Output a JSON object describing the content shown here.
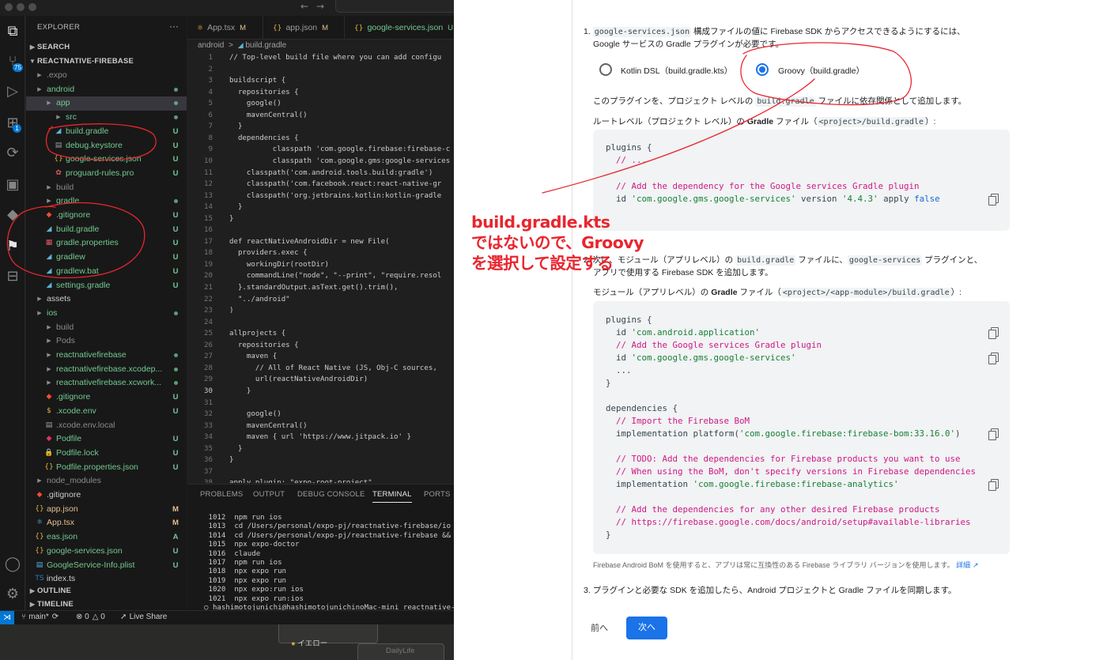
{
  "vscode": {
    "explorer_title": "EXPLORER",
    "search_section": "SEARCH",
    "project_section": "REACTNATIVE-FIREBASE",
    "outline_section": "OUTLINE",
    "timeline_section": "TIMELINE",
    "scm_badge": "75",
    "ext_badge": "1",
    "tree": [
      {
        "label": ".expo",
        "kind": "folder",
        "depth": 1,
        "color": "gray",
        "status": ""
      },
      {
        "label": "android",
        "kind": "folder",
        "depth": 1,
        "color": "green",
        "status": "dot"
      },
      {
        "label": "app",
        "kind": "folder",
        "depth": 2,
        "color": "green",
        "status": "dot",
        "selected": true
      },
      {
        "label": "src",
        "kind": "folder",
        "depth": 3,
        "color": "green",
        "status": "dot"
      },
      {
        "label": "build.gradle",
        "kind": "gradle",
        "depth": 3,
        "color": "green",
        "status": "U"
      },
      {
        "label": "debug.keystore",
        "kind": "file",
        "depth": 3,
        "color": "green",
        "status": "U"
      },
      {
        "label": "google-services.json",
        "kind": "json",
        "depth": 3,
        "color": "green",
        "status": "U"
      },
      {
        "label": "proguard-rules.pro",
        "kind": "pro",
        "depth": 3,
        "color": "green",
        "status": "U"
      },
      {
        "label": "build",
        "kind": "folder",
        "depth": 2,
        "color": "gray",
        "status": ""
      },
      {
        "label": "gradle",
        "kind": "folder",
        "depth": 2,
        "color": "green",
        "status": "dot"
      },
      {
        "label": ".gitignore",
        "kind": "git",
        "depth": 2,
        "color": "green",
        "status": "U"
      },
      {
        "label": "build.gradle",
        "kind": "gradle",
        "depth": 2,
        "color": "green",
        "status": "U"
      },
      {
        "label": "gradle.properties",
        "kind": "props",
        "depth": 2,
        "color": "green",
        "status": "U"
      },
      {
        "label": "gradlew",
        "kind": "gradle",
        "depth": 2,
        "color": "green",
        "status": "U"
      },
      {
        "label": "gradlew.bat",
        "kind": "gradle",
        "depth": 2,
        "color": "green",
        "status": "U"
      },
      {
        "label": "settings.gradle",
        "kind": "gradle",
        "depth": 2,
        "color": "green",
        "status": "U"
      },
      {
        "label": "assets",
        "kind": "folder",
        "depth": 1,
        "color": "white",
        "status": ""
      },
      {
        "label": "ios",
        "kind": "folder",
        "depth": 1,
        "color": "green",
        "status": "dot"
      },
      {
        "label": "build",
        "kind": "folder",
        "depth": 2,
        "color": "gray",
        "status": ""
      },
      {
        "label": "Pods",
        "kind": "folder",
        "depth": 2,
        "color": "gray",
        "status": ""
      },
      {
        "label": "reactnativefirebase",
        "kind": "folder",
        "depth": 2,
        "color": "green",
        "status": "dot"
      },
      {
        "label": "reactnativefirebase.xcodep...",
        "kind": "folder",
        "depth": 2,
        "color": "green",
        "status": "dot"
      },
      {
        "label": "reactnativefirebase.xcwork...",
        "kind": "folder",
        "depth": 2,
        "color": "green",
        "status": "dot"
      },
      {
        "label": ".gitignore",
        "kind": "git",
        "depth": 2,
        "color": "green",
        "status": "U"
      },
      {
        "label": ".xcode.env",
        "kind": "env",
        "depth": 2,
        "color": "green",
        "status": "U"
      },
      {
        "label": ".xcode.env.local",
        "kind": "file",
        "depth": 2,
        "color": "gray",
        "status": ""
      },
      {
        "label": "Podfile",
        "kind": "ruby",
        "depth": 2,
        "color": "green",
        "status": "U"
      },
      {
        "label": "Podfile.lock",
        "kind": "lock",
        "depth": 2,
        "color": "green",
        "status": "U"
      },
      {
        "label": "Podfile.properties.json",
        "kind": "json",
        "depth": 2,
        "color": "green",
        "status": "U"
      },
      {
        "label": "node_modules",
        "kind": "folder",
        "depth": 1,
        "color": "gray",
        "status": ""
      },
      {
        "label": ".gitignore",
        "kind": "git",
        "depth": 1,
        "color": "white",
        "status": ""
      },
      {
        "label": "app.json",
        "kind": "json",
        "depth": 1,
        "color": "orange",
        "status": "M"
      },
      {
        "label": "App.tsx",
        "kind": "tsx",
        "depth": 1,
        "color": "orange",
        "status": "M"
      },
      {
        "label": "eas.json",
        "kind": "json",
        "depth": 1,
        "color": "green",
        "status": "A"
      },
      {
        "label": "google-services.json",
        "kind": "json",
        "depth": 1,
        "color": "green",
        "status": "U"
      },
      {
        "label": "GoogleService-Info.plist",
        "kind": "plist",
        "depth": 1,
        "color": "green",
        "status": "U"
      },
      {
        "label": "index.ts",
        "kind": "ts",
        "depth": 1,
        "color": "white",
        "status": ""
      }
    ],
    "tabs": [
      {
        "label": "App.tsx",
        "mod": "M"
      },
      {
        "label": "app.json",
        "mod": "M"
      },
      {
        "label": "google-services.json",
        "mod": "U"
      }
    ],
    "breadcrumb": {
      "folder": "android",
      "sep": ">",
      "file": "build.gradle"
    },
    "code_lines": [
      {
        "n": "1",
        "t": "// Top-level build file where you can add configu"
      },
      {
        "n": "2",
        "t": ""
      },
      {
        "n": "3",
        "t": "buildscript {"
      },
      {
        "n": "4",
        "t": "  repositories {"
      },
      {
        "n": "5",
        "t": "    google()"
      },
      {
        "n": "6",
        "t": "    mavenCentral()"
      },
      {
        "n": "7",
        "t": "  }"
      },
      {
        "n": "8",
        "t": "  dependencies {"
      },
      {
        "n": "9",
        "t": "          classpath 'com.google.firebase:firebase-c"
      },
      {
        "n": "10",
        "t": "          classpath 'com.google.gms:google-services"
      },
      {
        "n": "11",
        "t": "    classpath('com.android.tools.build:gradle')"
      },
      {
        "n": "12",
        "t": "    classpath('com.facebook.react:react-native-gr"
      },
      {
        "n": "13",
        "t": "    classpath('org.jetbrains.kotlin:kotlin-gradle"
      },
      {
        "n": "14",
        "t": "  }"
      },
      {
        "n": "15",
        "t": "}"
      },
      {
        "n": "16",
        "t": ""
      },
      {
        "n": "17",
        "t": "def reactNativeAndroidDir = new File("
      },
      {
        "n": "18",
        "t": "  providers.exec {"
      },
      {
        "n": "19",
        "t": "    workingDir(rootDir)"
      },
      {
        "n": "20",
        "t": "    commandLine(\"node\", \"--print\", \"require.resol"
      },
      {
        "n": "21",
        "t": "  }.standardOutput.asText.get().trim(),"
      },
      {
        "n": "22",
        "t": "  \"../android\""
      },
      {
        "n": "23",
        "t": ")"
      },
      {
        "n": "24",
        "t": ""
      },
      {
        "n": "25",
        "t": "allprojects {"
      },
      {
        "n": "26",
        "t": "  repositories {"
      },
      {
        "n": "27",
        "t": "    maven {"
      },
      {
        "n": "28",
        "t": "      // All of React Native (JS, Obj-C sources,"
      },
      {
        "n": "29",
        "t": "      url(reactNativeAndroidDir)"
      },
      {
        "n": "30",
        "t": "    }"
      },
      {
        "n": "31",
        "t": ""
      },
      {
        "n": "32",
        "t": "    google()"
      },
      {
        "n": "33",
        "t": "    mavenCentral()"
      },
      {
        "n": "34",
        "t": "    maven { url 'https://www.jitpack.io' }"
      },
      {
        "n": "35",
        "t": "  }"
      },
      {
        "n": "36",
        "t": "}"
      },
      {
        "n": "37",
        "t": ""
      },
      {
        "n": "38",
        "t": "apply plugin: \"expo-root-project\""
      }
    ],
    "current_line": "30",
    "panel_tabs": [
      "PROBLEMS",
      "OUTPUT",
      "DEBUG CONSOLE",
      "TERMINAL",
      "PORTS"
    ],
    "active_panel_tab": "TERMINAL",
    "terminal_lines": [
      " 1012  npm run ios",
      " 1013  cd /Users/personal/expo-pj/reactnative-firebase/io",
      " 1014  cd /Users/personal/expo-pj/reactnative-firebase &&",
      " 1015  npx expo-doctor",
      " 1016  claude",
      " 1017  npm run ios",
      " 1018  npx expo run",
      " 1019  npx expo run",
      " 1020  npx expo:run ios",
      " 1021  npx expo run:ios",
      "○ hashimotojunichi@hashimotojunichinoMac-mini reactnative-f"
    ],
    "status": {
      "branch": "main*",
      "errors": "0",
      "warnings": "0",
      "live_share": "Live Share"
    }
  },
  "desktop": {
    "items": [
      "イエロー",
      "DailyLife"
    ]
  },
  "firebase": {
    "step1_num": "1.",
    "step1_code": "google-services.json",
    "step1_text_a": " 構成ファイルの値に Firebase SDK からアクセスできるようにするには、",
    "step1_text_b": "Google サービスの Gradle プラグインが必要です。",
    "radio_options": [
      {
        "label": "Kotlin DSL（build.gradle.kts）",
        "selected": false
      },
      {
        "label": "Groovy（build.gradle）",
        "selected": true
      }
    ],
    "plugin_text_a": "このプラグインを、プロジェクト レベルの ",
    "plugin_text_code": "build.gradle",
    "plugin_text_b": " ファイルに依存関係として追加します。",
    "root_label_a": "ルートレベル（プロジェクト レベル）の ",
    "root_label_bold": "Gradle",
    "root_label_b": " ファイル（",
    "root_label_code": "<project>/build.gradle",
    "root_label_c": "）:",
    "code1": {
      "l1": "plugins {",
      "l2": "  // ...",
      "l3": "  // Add the dependency for the Google services Gradle plugin",
      "l4_a": "  id ",
      "l4_b": "'com.google.gms.google-services'",
      "l4_c": " version ",
      "l4_d": "'4.4.3'",
      "l4_e": " apply ",
      "l4_f": "false",
      "l5": "}"
    },
    "step2_num": "2.",
    "step2_a": "次に、モジュール（アプリレベル）の ",
    "step2_code1": "build.gradle",
    "step2_b": " ファイルに、",
    "step2_code2": "google-services",
    "step2_c": " プラグインと、",
    "step2_d": "アプリで使用する Firebase SDK を追加します。",
    "module_label_a": "モジュール（アプリレベル）の ",
    "module_label_bold": "Gradle",
    "module_label_b": " ファイル（",
    "module_label_code": "<project>/<app-module>/build.gradle",
    "module_label_c": "）:",
    "code2": {
      "l1": "plugins {",
      "l2_a": "  id ",
      "l2_b": "'com.android.application'",
      "l3": "  // Add the Google services Gradle plugin",
      "l4_a": "  id ",
      "l4_b": "'com.google.gms.google-services'",
      "l5": "  ...",
      "l6": "}",
      "l7": "dependencies {",
      "l8": "  // Import the Firebase BoM",
      "l9_a": "  implementation platform(",
      "l9_b": "'com.google.firebase:firebase-bom:33.16.0'",
      "l9_c": ")",
      "l10": "  // TODO: Add the dependencies for Firebase products you want to use",
      "l11": "  // When using the BoM, don't specify versions in Firebase dependencies",
      "l12_a": "  implementation ",
      "l12_b": "'com.google.firebase:firebase-analytics'",
      "l13": "  // Add the dependencies for any other desired Firebase products",
      "l14": "  // https://firebase.google.com/docs/android/setup#available-libraries",
      "l15": "}"
    },
    "bom_note": "Firebase Android BoM を使用すると、アプリは常に互換性のある Firebase ライブラリ バージョンを使用します。",
    "bom_link": "詳細",
    "step3_num": "3.",
    "step3_text": "プラグインと必要な SDK を追加したら、Android プロジェクトと Gradle ファイルを同期します。",
    "prev_label": "前へ",
    "next_label": "次へ"
  },
  "annotation": {
    "lines": [
      "build.gradle.kts",
      "ではないので、Groovy",
      "を選択して設定する"
    ],
    "color": "#e8262f"
  }
}
